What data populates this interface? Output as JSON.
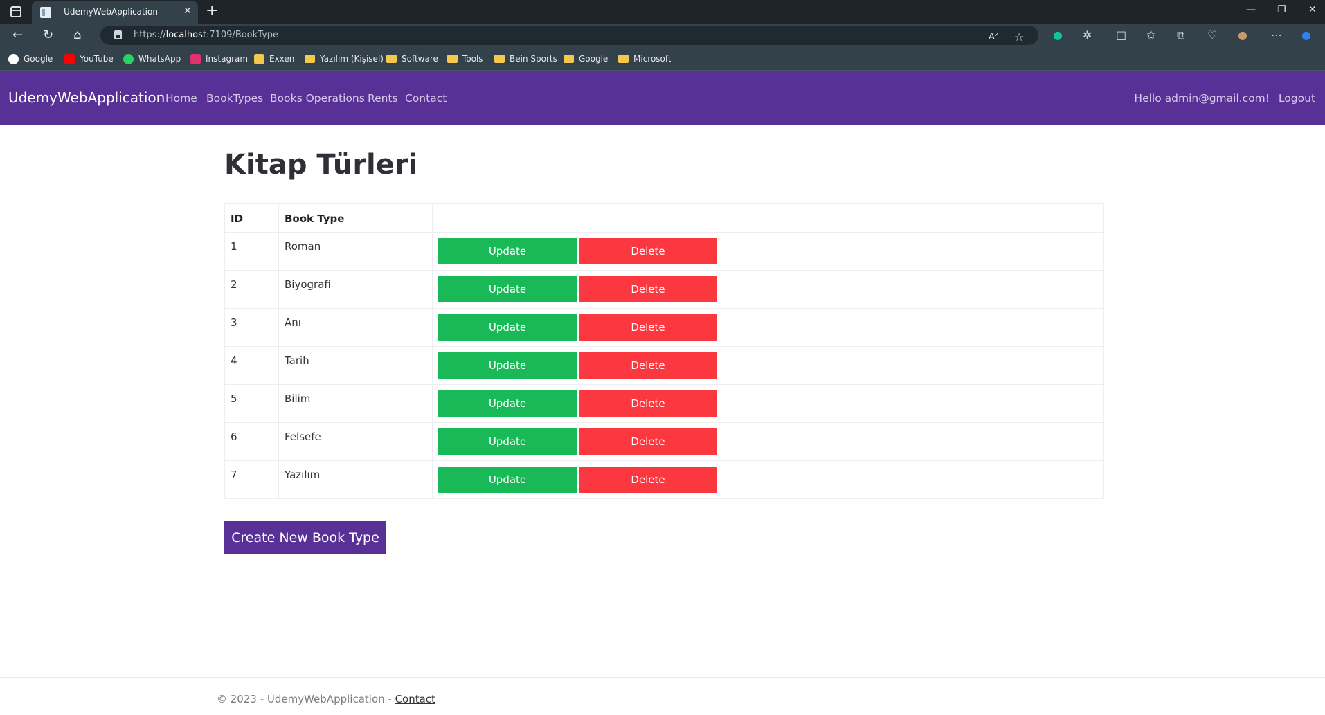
{
  "browser": {
    "tab_title": "- UdemyWebApplication",
    "url_prefix": "https://",
    "url_host": "localhost",
    "url_path": ":7109/BookType",
    "bookmarks": [
      {
        "label": "Google",
        "icon": "google-icon",
        "color": "#ffffff"
      },
      {
        "label": "YouTube",
        "icon": "youtube-icon",
        "color": "#ff0000"
      },
      {
        "label": "WhatsApp",
        "icon": "whatsapp-icon",
        "color": "#25d366"
      },
      {
        "label": "Instagram",
        "icon": "instagram-icon",
        "color": "#e1306c"
      },
      {
        "label": "Exxen",
        "icon": "exxen-icon",
        "color": "#f2c94c"
      },
      {
        "label": "Yazılım (Kişisel)",
        "icon": "folder-icon"
      },
      {
        "label": "Software",
        "icon": "folder-icon"
      },
      {
        "label": "Tools",
        "icon": "folder-icon"
      },
      {
        "label": "Bein Sports",
        "icon": "folder-icon"
      },
      {
        "label": "Google",
        "icon": "folder-icon"
      },
      {
        "label": "Microsoft",
        "icon": "folder-icon"
      }
    ]
  },
  "navbar": {
    "brand": "UdemyWebApplication",
    "links": [
      "Home",
      "BookTypes",
      "Books Operations",
      "Rents",
      "Contact"
    ],
    "greeting": "Hello admin@gmail.com!",
    "logout": "Logout",
    "color": "#593196"
  },
  "main": {
    "title": "Kitap Türleri",
    "table": {
      "headers": [
        "ID",
        "Book Type"
      ],
      "rows": [
        {
          "id": "1",
          "type": "Roman"
        },
        {
          "id": "2",
          "type": "Biyografi"
        },
        {
          "id": "3",
          "type": "Anı"
        },
        {
          "id": "4",
          "type": "Tarih"
        },
        {
          "id": "5",
          "type": "Bilim"
        },
        {
          "id": "6",
          "type": "Felsefe"
        },
        {
          "id": "7",
          "type": "Yazılım"
        }
      ],
      "update_label": "Update",
      "delete_label": "Delete",
      "update_color": "#18b956",
      "delete_color": "#fb3840"
    },
    "create_label": "Create New Book Type"
  },
  "footer": {
    "text": "© 2023 - UdemyWebApplication - ",
    "link": "Contact"
  }
}
